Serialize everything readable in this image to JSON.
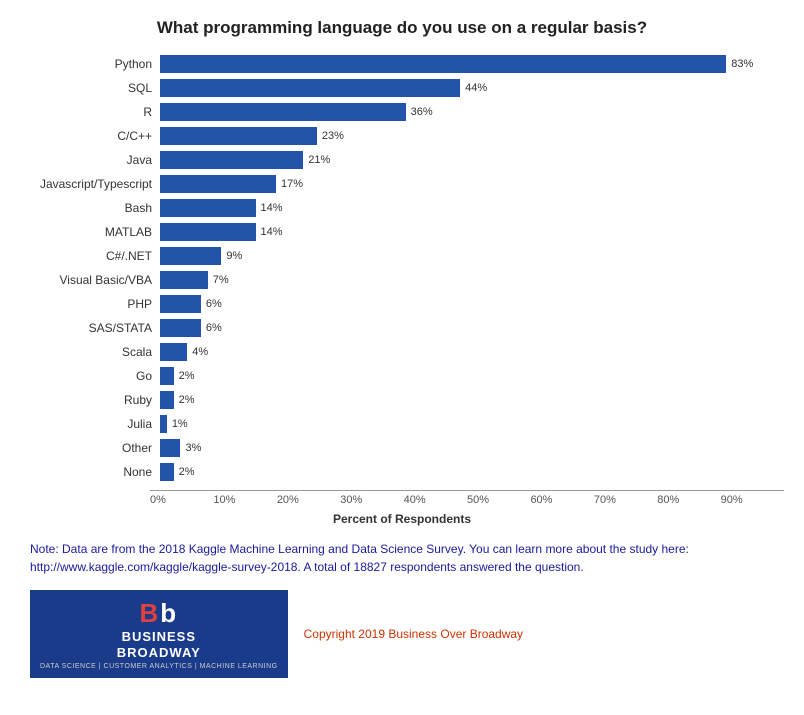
{
  "title": "What programming language do you use on a regular basis?",
  "bars": [
    {
      "label": "Python",
      "value": 83,
      "display": "83%"
    },
    {
      "label": "SQL",
      "value": 44,
      "display": "44%"
    },
    {
      "label": "R",
      "value": 36,
      "display": "36%"
    },
    {
      "label": "C/C++",
      "value": 23,
      "display": "23%"
    },
    {
      "label": "Java",
      "value": 21,
      "display": "21%"
    },
    {
      "label": "Javascript/Typescript",
      "value": 17,
      "display": "17%"
    },
    {
      "label": "Bash",
      "value": 14,
      "display": "14%"
    },
    {
      "label": "MATLAB",
      "value": 14,
      "display": "14%"
    },
    {
      "label": "C#/.NET",
      "value": 9,
      "display": "9%"
    },
    {
      "label": "Visual Basic/VBA",
      "value": 7,
      "display": "7%"
    },
    {
      "label": "PHP",
      "value": 6,
      "display": "6%"
    },
    {
      "label": "SAS/STATA",
      "value": 6,
      "display": "6%"
    },
    {
      "label": "Scala",
      "value": 4,
      "display": "4%"
    },
    {
      "label": "Go",
      "value": 2,
      "display": "2%"
    },
    {
      "label": "Ruby",
      "value": 2,
      "display": "2%"
    },
    {
      "label": "Julia",
      "value": 1,
      "display": "1%"
    },
    {
      "label": "Other",
      "value": 3,
      "display": "3%"
    },
    {
      "label": "None",
      "value": 2,
      "display": "2%"
    }
  ],
  "x_axis": {
    "ticks": [
      "0%",
      "10%",
      "20%",
      "30%",
      "40%",
      "50%",
      "60%",
      "70%",
      "80%",
      "90%"
    ],
    "max": 90,
    "label": "Percent of Respondents"
  },
  "note": "Note: Data are from the 2018 Kaggle Machine Learning and Data Science Survey. You can learn more about the study here: http://www.kaggle.com/kaggle/kaggle-survey-2018.  A total of 18827 respondents answered the question.",
  "logo": {
    "bb": "Bb",
    "name1": "BUSINESS",
    "name2": "BROADWAY",
    "sub": "DATA SCIENCE  |  CUSTOMER ANALYTICS  |  MACHINE LEARNING"
  },
  "copyright": "Copyright 2019 Business Over Broadway"
}
